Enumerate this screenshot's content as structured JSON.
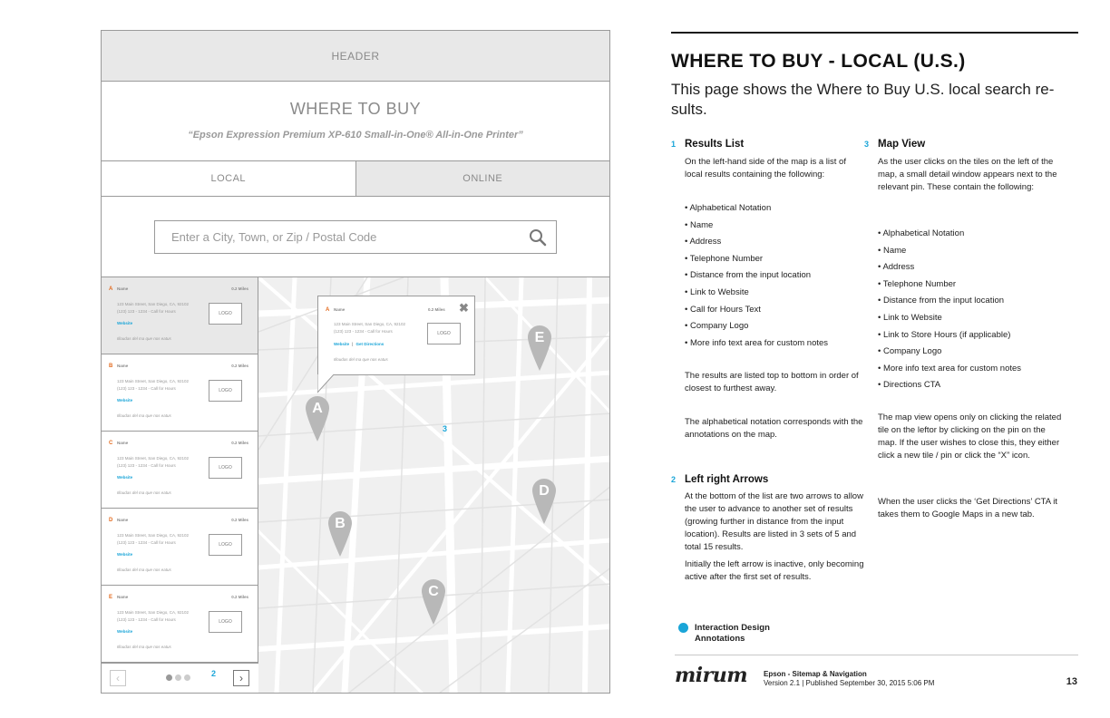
{
  "wireframe": {
    "header": "HEADER",
    "title": "WHERE TO BUY",
    "product": "“Epson Expression Premium XP-610 Small-in-One® All-in-One Printer”",
    "tabs": [
      {
        "label": "LOCAL",
        "active": true
      },
      {
        "label": "ONLINE",
        "active": false
      }
    ],
    "search": {
      "placeholder": "Enter a City, Town, or Zip / Postal Code",
      "icon": "search-icon"
    },
    "results": [
      {
        "letter": "A",
        "name": "Name",
        "distance": "0.2 Miles",
        "address": "123 Main Street, San Diego, CA, 92102",
        "phone": "(123) 123 - 1234 - Call for Hours",
        "website": "Website",
        "logo": "LOGO",
        "note": "Illoudas del ma que nos eatus"
      },
      {
        "letter": "B",
        "name": "Name",
        "distance": "0.2 Miles",
        "address": "123 Main Street, San Diego, CA, 92102",
        "phone": "(123) 123 - 1234 - Call for Hours",
        "website": "Website",
        "logo": "LOGO",
        "note": "Illoudas del ma que nos eatus"
      },
      {
        "letter": "C",
        "name": "Name",
        "distance": "0.2 Miles",
        "address": "123 Main Street, San Diego, CA, 92102",
        "phone": "(123) 123 - 1234 - Call for Hours",
        "website": "Website",
        "logo": "LOGO",
        "note": "Illoudas del ma que nos eatus"
      },
      {
        "letter": "D",
        "name": "Name",
        "distance": "0.2 Miles",
        "address": "123 Main Street, San Diego, CA, 92102",
        "phone": "(123) 123 - 1234 - Call for Hours",
        "website": "Website",
        "logo": "LOGO",
        "note": "Illoudas del ma que nos eatus"
      },
      {
        "letter": "E",
        "name": "Name",
        "distance": "0.2 Miles",
        "address": "123 Main Street, San Diego, CA, 92102",
        "phone": "(123) 123 - 1234 - Call for Hours",
        "website": "Website",
        "logo": "LOGO",
        "note": "Illoudas del ma que nos eatus"
      }
    ],
    "pager": {
      "prev": "‹",
      "next": "›",
      "annotation": "2",
      "page": 1,
      "pages": 3
    },
    "map": {
      "annotation": "3",
      "pins": [
        "A",
        "B",
        "C",
        "D",
        "E"
      ],
      "popup": {
        "letter": "A",
        "name": "Name",
        "distance": "0.2 Miles",
        "address": "123 Main Street, San Diego, CA, 92102",
        "phone": "(123) 123 - 1234 - Call for Hours",
        "website": "Website",
        "separator": "|",
        "directions": "Get Directions",
        "logo": "LOGO",
        "note": "Illoudas del ma que nos eatus",
        "close": "✖"
      }
    }
  },
  "doc": {
    "title": "WHERE TO BUY - LOCAL (U.S.)",
    "subtitle": "This page shows the Where to Buy U.S. local search re-sults.",
    "sections": {
      "results_list": {
        "num": "1",
        "heading": "Results List",
        "intro": "On the left-hand side of the map is a list of local results containing the following:",
        "items": [
          "• Alphabetical Notation",
          "• Name",
          "• Address",
          "• Telephone Number",
          "• Distance from the input location",
          "• Link to Website",
          "• Call for Hours Text",
          "• Company Logo",
          "• More info text area for custom notes"
        ],
        "order": "The results are listed top to bottom in order of closest to furthest away.",
        "notation": "The alphabetical notation corresponds with the annotations on the map."
      },
      "arrows": {
        "num": "2",
        "heading": "Left right Arrows",
        "body": "At the bottom of the list are two arrows to allow the user to advance to another set of results (growing further in distance from the input location). Results are listed in 3 sets of 5 and total 15 results.",
        "body2": "Initially the left arrow is inactive, only becoming active after the first set of results."
      },
      "map_view": {
        "num": "3",
        "heading": "Map View",
        "intro": "As the user clicks on the tiles on the left of the map, a small detail window appears next to the relevant pin. These contain the following:",
        "items": [
          "• Alphabetical Notation",
          "• Name",
          "• Address",
          "• Telephone Number",
          "• Distance from the input location",
          "• Link to Website",
          "• Link to Store Hours (if applicable)",
          "• Company Logo",
          "• More info text area for custom notes",
          "• Directions CTA"
        ],
        "opens": "The map view opens only on clicking the related tile on the leftor by clicking on the pin on the map. If the user wishes to close this, they either click a new tile / pin or click the “X” icon.",
        "directions": "When the user clicks the ‘Get Directions’ CTA it takes them to Google Maps in a new tab."
      }
    },
    "legend": {
      "line1": "Interaction Design",
      "line2": "Annotations",
      "color": "#1aa5d8"
    },
    "footer": {
      "brand": "mirum",
      "doc": "Epson - Sitemap & Navigation",
      "version": "Version 2.1  |  Published September 30, 2015 5:06 PM",
      "page": "13"
    }
  },
  "colors": {
    "accent": "#1aa5d8",
    "letter": "#e36b1f",
    "wireframe_gray": "#e8e8e8",
    "pin": "#b8b8b8"
  }
}
